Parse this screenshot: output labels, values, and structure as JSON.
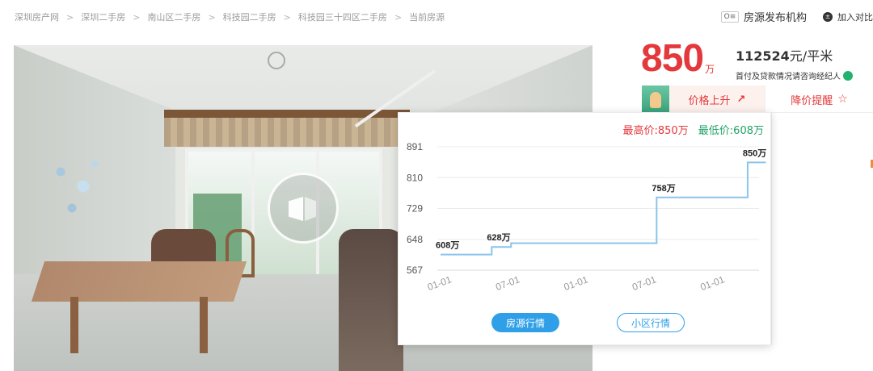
{
  "breadcrumb": [
    "深圳房产网",
    "深圳二手房",
    "南山区二手房",
    "科技园二手房",
    "科技园三十四区二手房",
    "当前房源"
  ],
  "breadcrumb_sep": ">",
  "header": {
    "publisher_label": "房源发布机构",
    "publisher_icon_text": "O≡",
    "compare_label": "加入对比",
    "compare_icon_text": "±"
  },
  "listing": {
    "total_price": "850",
    "total_price_unit": "万",
    "unit_price_value": "112524",
    "unit_price_suffix": "元/平米",
    "loan_hint": "首付及贷款情况请咨询经纪人"
  },
  "actions": {
    "price_trend_label": "价格上升",
    "price_trend_icon": "↗",
    "price_alert_label": "降价提醒",
    "price_alert_icon": "☆"
  },
  "chart_popover": {
    "max_price_label": "最高价:850万",
    "min_price_label": "最低价:608万",
    "tabs": {
      "house": "房源行情",
      "community": "小区行情"
    }
  },
  "colors": {
    "accent_red": "#e4393c",
    "accent_green": "#21a366",
    "accent_blue": "#2fa0e8",
    "line": "#8cc4ea"
  },
  "chart_data": {
    "type": "line",
    "title": "",
    "xlabel": "",
    "ylabel": "",
    "y_ticks": [
      891,
      810,
      729,
      648,
      567
    ],
    "ylim": [
      567,
      891
    ],
    "x_ticks": [
      "01-01",
      "07-01",
      "01-01",
      "07-01",
      "01-01"
    ],
    "x_tick_positions": [
      0,
      6,
      12,
      18,
      24
    ],
    "xlim": [
      0,
      28
    ],
    "step": true,
    "grid": true,
    "series": [
      {
        "points": [
          {
            "x": 0,
            "y": 608
          },
          {
            "x": 4.5,
            "y": 628
          },
          {
            "x": 6.2,
            "y": 638
          },
          {
            "x": 19,
            "y": 758
          },
          {
            "x": 27,
            "y": 850
          },
          {
            "x": 28.6,
            "y": 850
          }
        ]
      }
    ],
    "annotations": [
      {
        "x": 0,
        "y": 608,
        "text": "608万"
      },
      {
        "x": 4.5,
        "y": 628,
        "text": "628万"
      },
      {
        "x": 19,
        "y": 758,
        "text": "758万"
      },
      {
        "x": 27,
        "y": 850,
        "text": "850万"
      }
    ]
  }
}
